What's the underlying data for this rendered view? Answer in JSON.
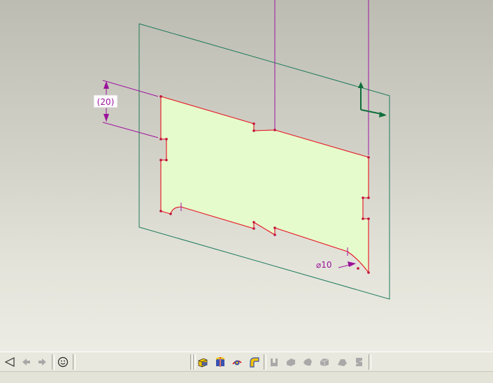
{
  "sketch": {
    "dimension_height": "(20)",
    "dimension_diameter": "⌀10"
  },
  "colors": {
    "datum_plane": "#1d7a5a",
    "sketch_edge": "#e8101c",
    "sketch_fill": "#e6fbcc",
    "dimension": "#9b119b",
    "vertex": "#c0103c",
    "csys": "#0f6f3c"
  },
  "toolbar": {
    "left_group": [
      "sketch-view-icon",
      "back-arrow-icon",
      "forward-arrow-icon",
      "smiley-icon"
    ],
    "middle_group": [
      "extrude-icon",
      "revolve-icon",
      "sweep-icon",
      "blend-icon"
    ],
    "right_group": [
      "hole-icon",
      "shell-icon",
      "rib-icon",
      "draft-icon",
      "round-icon",
      "chamfer-icon",
      "pattern-icon"
    ]
  }
}
